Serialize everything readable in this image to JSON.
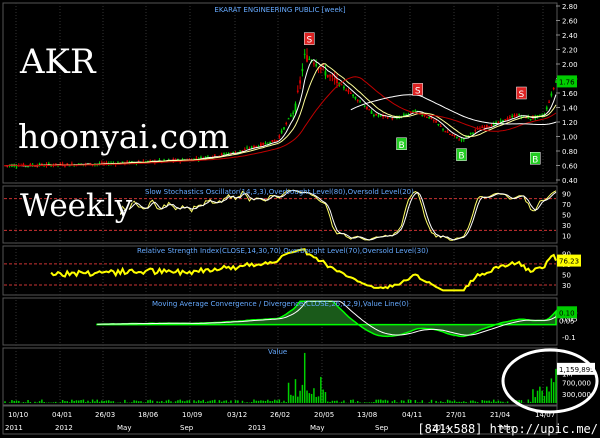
{
  "overlay": {
    "symbol": "AKR",
    "site": "hoonyai.com",
    "period": "Weekly",
    "watermark": "[841x588] http://upic.me/"
  },
  "colors": {
    "background": "#000000",
    "up_candle": "#00d000",
    "down_candle": "#e00000",
    "ma_fast": "#ffffff",
    "ma_slow": "#c00000",
    "ma_long": "#ffffff",
    "stoch_k": "#ffff66",
    "stoch_d": "#ffffff",
    "rsi": "#ffff00",
    "macd": "#00ff00",
    "signal": "#ffffff",
    "volume": "#00d000",
    "level_line": "#cc3333",
    "title": "#66aaff",
    "axis_text": "#ffffff",
    "highlight_circle": "#ffffff"
  },
  "chart_data": [
    {
      "type": "candlestick",
      "title": "EKARAT ENGINEERING PUBLIC [week]",
      "y_ticks": [
        "2.80",
        "2.60",
        "2.40",
        "2.20",
        "2.00",
        "1.80",
        "1.60",
        "1.40",
        "1.20",
        "1.00",
        "0.80",
        "0.60",
        "0.40"
      ],
      "ylim": [
        0.4,
        2.8
      ],
      "last_value": "1.76",
      "x_date_labels": [
        "10/10",
        "04/01",
        "26/03",
        "18/06",
        "10/09",
        "03/12",
        "26/02",
        "20/05",
        "13/08",
        "04/11",
        "27/01",
        "21/04",
        "14/07"
      ],
      "x_period_labels": [
        "2011",
        "2012",
        "May",
        "Sep",
        "2013",
        "May",
        "Sep",
        "2014",
        "May"
      ],
      "signals": [
        {
          "label": "S",
          "week": 132,
          "price": 2.35
        },
        {
          "label": "S",
          "week": 179,
          "price": 1.65
        },
        {
          "label": "S",
          "week": 224,
          "price": 1.6
        },
        {
          "label": "B",
          "week": 172,
          "price": 0.9
        },
        {
          "label": "B",
          "week": 198,
          "price": 0.75
        },
        {
          "label": "B",
          "week": 230,
          "price": 0.7
        }
      ]
    },
    {
      "type": "line",
      "title": "Slow Stochastics Oscillator(14,3,3),Overbought Level(80),Oversold Level(20)",
      "y_ticks": [
        "90",
        "70",
        "50",
        "30",
        "10"
      ],
      "ylim": [
        0,
        100
      ],
      "levels": [
        80,
        20
      ]
    },
    {
      "type": "line",
      "title": "Relative Strength Index(CLOSE,14,30,70),Overbought Level(70),Oversold Level(30)",
      "y_ticks": [
        "90",
        "70",
        "50",
        "30"
      ],
      "ylim": [
        15,
        100
      ],
      "levels": [
        70,
        30
      ],
      "last_value": "76.23"
    },
    {
      "type": "area",
      "title": "Moving Average Convergence / Divergence(CLOSE,26,12,9),Value Line(0)",
      "y_ticks": [
        "0.10",
        "0.05",
        "-0.1"
      ],
      "ylim": [
        -0.15,
        0.2
      ],
      "last_value_a": "0.10",
      "last_value_b": "0.05"
    },
    {
      "type": "bar",
      "title": "Value",
      "y_ticks": [
        "1M",
        "700,000",
        "300,000"
      ],
      "ylim": [
        0,
        1800000
      ],
      "last_value": "1,159,895"
    }
  ]
}
